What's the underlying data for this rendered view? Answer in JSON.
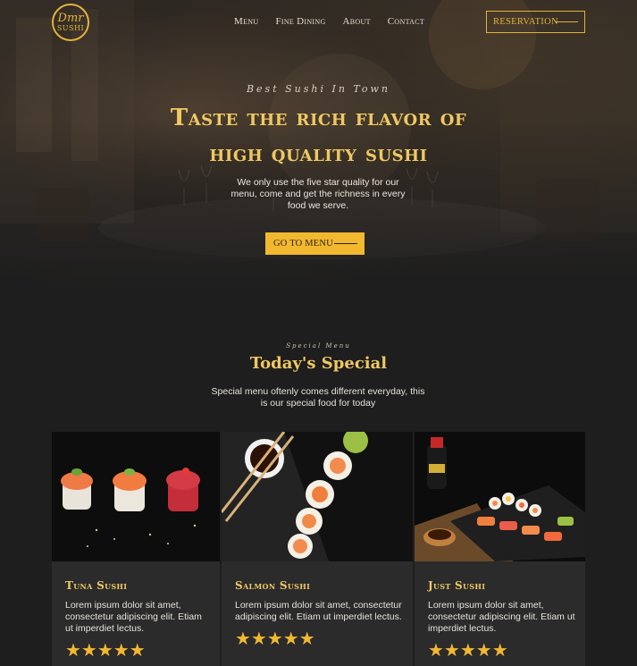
{
  "header": {
    "logo_line1": "Dmr",
    "logo_line2": "SUSHI",
    "nav": [
      "Menu",
      "Fine Dining",
      "About",
      "Contact"
    ],
    "reservation_label": "RESERVATION"
  },
  "hero": {
    "subtitle": "Best Sushi In Town",
    "title_line1": "Taste the rich flavor of",
    "title_line2": "high quality sushi",
    "description": "We only use the five star quality for our menu, come and get the richness in every food we serve.",
    "button_label": "GO TO MENU"
  },
  "special": {
    "subtitle": "Special Menu",
    "title": "Today's Special",
    "description": "Special menu oftenly comes different everyday, this is our special food for today",
    "cards": [
      {
        "name": "Tuna Sushi",
        "text": "Lorem ipsum dolor sit amet, consectetur adipiscing elit. Etiam ut imperdiet lectus.",
        "stars": "★★★★★",
        "rating": 5
      },
      {
        "name": "Salmon Sushi",
        "text": "Lorem ipsum dolor sit amet, consectetur adipiscing elit. Etiam ut imperdiet lectus.",
        "stars": "★★★★★",
        "rating": 5
      },
      {
        "name": "Just Sushi",
        "text": "Lorem ipsum dolor sit amet, consectetur adipiscing elit. Etiam ut imperdiet lectus.",
        "stars": "★★★★★",
        "rating": 5
      }
    ]
  },
  "colors": {
    "accent": "#f2b82f",
    "gold_text": "#f0c862",
    "background": "#1e1e1e",
    "card": "#2b2b2c"
  }
}
